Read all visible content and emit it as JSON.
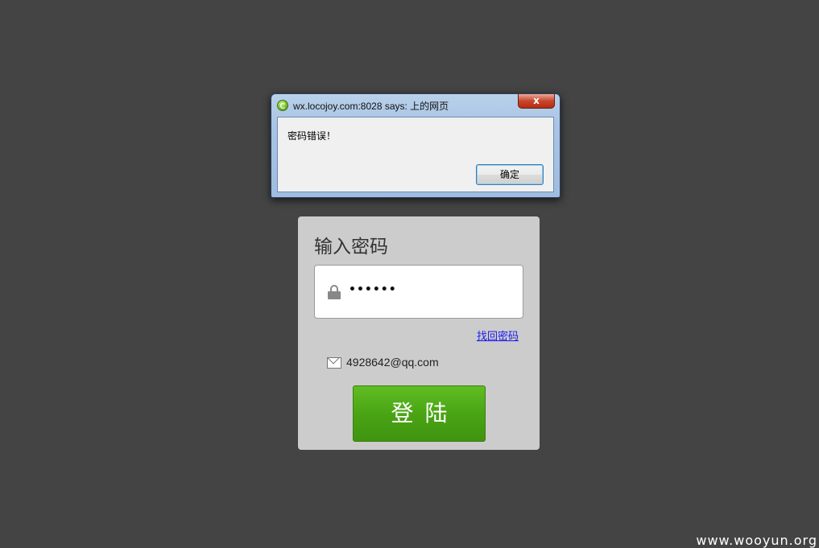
{
  "alert": {
    "title": "wx.locojoy.com:8028 says: 上的网页",
    "close_label": "x",
    "message": "密码错误！",
    "ok_label": "确定"
  },
  "login": {
    "title": "输入密码",
    "password_value": "••••••",
    "forgot_link": "找回密码",
    "email": "4928642@qq.com",
    "submit_label": "登陆"
  },
  "watermark": "www.wooyun.org",
  "icons": {
    "app": "ie-icon",
    "password": "lock-icon",
    "email": "mail-icon"
  },
  "colors": {
    "background": "#444444",
    "panel": "#cccccc",
    "button": "#4aa414",
    "link": "#1a1aee"
  }
}
